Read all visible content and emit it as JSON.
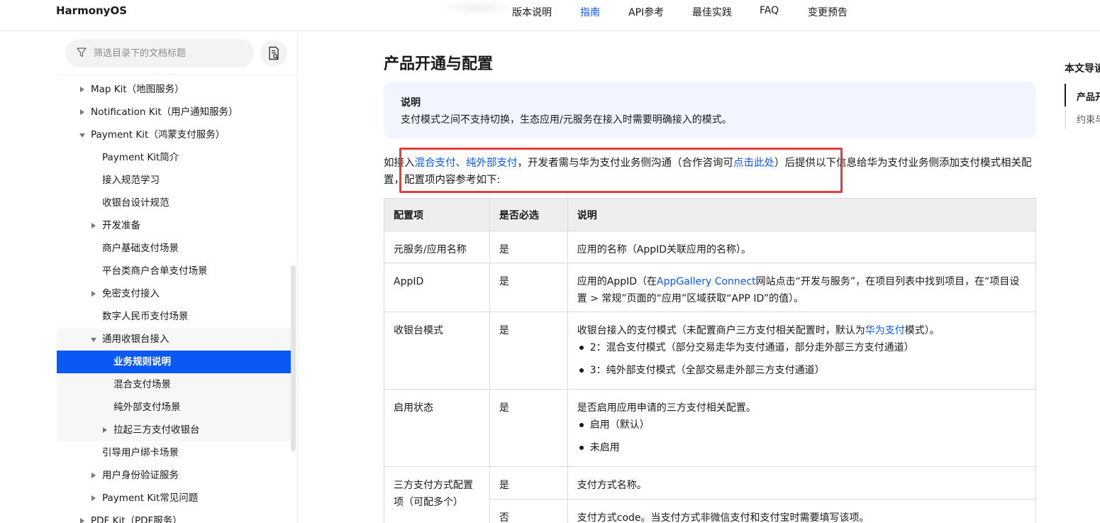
{
  "header": {
    "brand": "HarmonyOS",
    "nav": [
      "版本说明",
      "指南",
      "API参考",
      "最佳实践",
      "FAQ",
      "变更预告"
    ],
    "active_nav": "指南",
    "accent_color": "#0a59f7"
  },
  "sidebar": {
    "filter_placeholder": "筛选目录下的文档标题",
    "filter_icon": "funnel-icon",
    "doc_button_icon": "document-search-icon",
    "items": [
      {
        "label": "Map Kit（地图服务）",
        "level": 0,
        "arrow": "right"
      },
      {
        "label": "Notification Kit（用户通知服务）",
        "level": 0,
        "arrow": "right"
      },
      {
        "label": "Payment Kit（鸿蒙支付服务）",
        "level": 0,
        "arrow": "down"
      },
      {
        "label": "Payment Kit简介",
        "level": 1,
        "arrow": ""
      },
      {
        "label": "接入规范学习",
        "level": 1,
        "arrow": ""
      },
      {
        "label": "收银台设计规范",
        "level": 1,
        "arrow": ""
      },
      {
        "label": "开发准备",
        "level": 1,
        "arrow": "right"
      },
      {
        "label": "商户基础支付场景",
        "level": 1,
        "arrow": ""
      },
      {
        "label": "平台类商户合单支付场景",
        "level": 1,
        "arrow": ""
      },
      {
        "label": "免密支付接入",
        "level": 1,
        "arrow": "right"
      },
      {
        "label": "数字人民币支付场景",
        "level": 1,
        "arrow": ""
      },
      {
        "label": "通用收银台接入",
        "level": 1,
        "arrow": "down"
      },
      {
        "label": "业务规则说明",
        "level": 2,
        "arrow": ""
      },
      {
        "label": "混合支付场景",
        "level": 2,
        "arrow": ""
      },
      {
        "label": "纯外部支付场景",
        "level": 2,
        "arrow": ""
      },
      {
        "label": "拉起三方支付收银台",
        "level": 2,
        "arrow": "right"
      },
      {
        "label": "引导用户绑卡场景",
        "level": 1,
        "arrow": ""
      },
      {
        "label": "用户身份验证服务",
        "level": 1,
        "arrow": "right"
      },
      {
        "label": "Payment Kit常见问题",
        "level": 1,
        "arrow": "right"
      },
      {
        "label": "PDF Kit（PDF服务）",
        "level": 0,
        "arrow": "right"
      }
    ],
    "active_item": "业务规则说明"
  },
  "main": {
    "title": "产品开通与配置",
    "note": {
      "title": "说明",
      "body": "支付模式之间不支持切换，生态应用/元服务在接入时需要明确接入的模式。"
    },
    "intro": {
      "p1": "如接入",
      "link1": "混合支付",
      "sep": "、",
      "link2": "纯外部支付",
      "p2": "，开发者需与华为支付业务侧沟通（合作咨询可",
      "link3": "点击此处",
      "p3": "）后提供以下信息给华为支付业务侧添加支付模式相关配置，配置项内容参考如下:"
    },
    "highlight_color": "#e53c3c",
    "table": {
      "headers": [
        "配置项",
        "是否必选",
        "说明"
      ],
      "rows": {
        "r1": {
          "item": "元服务/应用名称",
          "required": "是",
          "desc": "应用的名称（AppID关联应用的名称）。"
        },
        "r2": {
          "item": "AppID",
          "required": "是",
          "desc_pre": "应用的AppID（在",
          "desc_link": "AppGallery Connect",
          "desc_post": "网站点击“开发与服务”，在项目列表中找到项目，在“项目设置 > 常规”页面的“应用”区域获取“APP ID”的值）。"
        },
        "r3": {
          "item": "收银台模式",
          "required": "是",
          "desc_pre": "收银台接入的支付模式（未配置商户三方支付相关配置时，默认为",
          "desc_link": "华为支付",
          "desc_post": "模式）。",
          "b1": "2：混合支付模式（部分交易走华为支付通道，部分走外部三方支付通道）",
          "b2": "3：纯外部支付模式（全部交易走外部三方支付通道）"
        },
        "r4": {
          "item": "启用状态",
          "required": "是",
          "desc": "是否启用应用申请的三方支付相关配置。",
          "b1": "启用（默认）",
          "b2": "未启用"
        },
        "r5": {
          "item": "三方支付方式配置项（可配多个）",
          "required": "是",
          "desc": "支付方式名称。"
        },
        "r6": {
          "required": "否",
          "desc": "支付方式code。当支付方式非微信支付和支付宝时需要填写该项。"
        }
      }
    }
  },
  "toc": {
    "title": "本文导读",
    "items": [
      "产品开通与配置",
      "约束与限制"
    ]
  }
}
